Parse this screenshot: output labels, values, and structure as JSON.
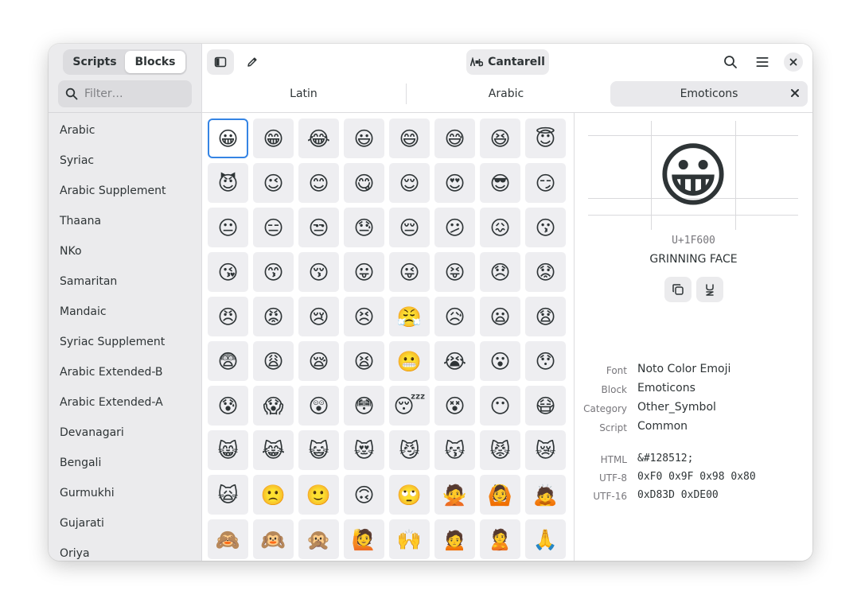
{
  "sidebar": {
    "segments": [
      {
        "label": "Scripts",
        "active": false
      },
      {
        "label": "Blocks",
        "active": true
      }
    ],
    "filter_placeholder": "Filter…",
    "blocks": [
      "Arabic",
      "Syriac",
      "Arabic Supplement",
      "Thaana",
      "NKo",
      "Samaritan",
      "Mandaic",
      "Syriac Supplement",
      "Arabic Extended-B",
      "Arabic Extended-A",
      "Devanagari",
      "Bengali",
      "Gurmukhi",
      "Gujarati",
      "Oriya"
    ]
  },
  "header": {
    "font_button_label": "Cantarell"
  },
  "tabs": [
    {
      "label": "Latin",
      "active": false
    },
    {
      "label": "Arabic",
      "active": false
    },
    {
      "label": "Emoticons",
      "active": true
    }
  ],
  "grid": {
    "emojis": [
      "😀",
      "😁",
      "😂",
      "😃",
      "😄",
      "😅",
      "😆",
      "😇",
      "😈",
      "😉",
      "😊",
      "😋",
      "😌",
      "😍",
      "😎",
      "😏",
      "😐",
      "😑",
      "😒",
      "😓",
      "😔",
      "😕",
      "😖",
      "😗",
      "😘",
      "😙",
      "😚",
      "😛",
      "😜",
      "😝",
      "😞",
      "😟",
      "😠",
      "😡",
      "😢",
      "😣",
      "😤",
      "😥",
      "😦",
      "😧",
      "😨",
      "😩",
      "😪",
      "😫",
      "😬",
      "😭",
      "😮",
      "😯",
      "😰",
      "😱",
      "😲",
      "😳",
      "😴",
      "😵",
      "😶",
      "😷",
      "😸",
      "😹",
      "😺",
      "😻",
      "😼",
      "😽",
      "😾",
      "😿",
      "🙀",
      "🙁",
      "🙂",
      "🙃",
      "🙄",
      "🙅",
      "🙆",
      "🙇",
      "🙈",
      "🙉",
      "🙊",
      "🙋",
      "🙌",
      "🙍",
      "🙎",
      "🙏"
    ],
    "selected_index": 0
  },
  "details": {
    "glyph": "😀",
    "codepoint": "U+1F600",
    "name": "GRINNING FACE",
    "properties": [
      {
        "label": "Font",
        "value": "Noto Color Emoji"
      },
      {
        "label": "Block",
        "value": "Emoticons"
      },
      {
        "label": "Category",
        "value": "Other_Symbol"
      },
      {
        "label": "Script",
        "value": "Common"
      }
    ],
    "encodings": [
      {
        "label": "HTML",
        "value": "&#128512;"
      },
      {
        "label": "UTF-8",
        "value": "0xF0 0x9F 0x98 0x80"
      },
      {
        "label": "UTF-16",
        "value": "0xD83D 0xDE00"
      }
    ]
  },
  "icons": [
    "sidebar-toggle-icon",
    "pencil-icon",
    "font-icon",
    "search-icon",
    "hamburger-menu-icon",
    "close-icon",
    "copy-icon",
    "unicode-mark-icon"
  ],
  "colors": {
    "accent": "#3584e4",
    "sidebar_bg": "#ebebed",
    "cell_bg": "#eeeef1"
  }
}
